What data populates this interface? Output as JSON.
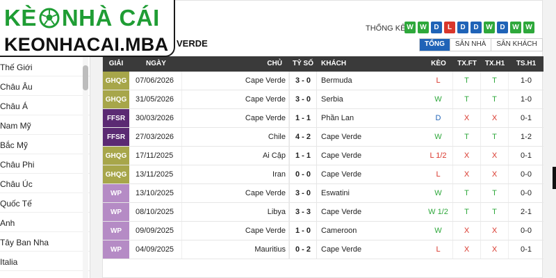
{
  "logo": {
    "line1_a": "KÈ",
    "line1_b": " NHÀ CÁI",
    "line2": "KEONHACAI.MBA"
  },
  "sidebar": {
    "items": [
      "Thế Giới",
      "Châu Âu",
      "Châu Á",
      "Nam Mỹ",
      "Bắc Mỹ",
      "Châu Phi",
      "Châu Úc",
      "Quốc Tế",
      "Anh",
      "Tây Ban Nha",
      "Italia"
    ]
  },
  "header": {
    "team_name": "VERDE",
    "stats_label": "THỐNG KÊ",
    "form": [
      "W",
      "W",
      "D",
      "L",
      "D",
      "D",
      "W",
      "D",
      "W",
      "W"
    ],
    "tabs": [
      "TỔNG",
      "SÂN NHÀ",
      "SÂN KHÁCH"
    ]
  },
  "table": {
    "headers": {
      "league": "GIẢI",
      "date": "NGÀY",
      "home": "CHỦ",
      "score": "TỶ SỐ",
      "away": "KHÁCH",
      "keo": "KÈO",
      "txft": "TX.FT",
      "txh1": "TX.H1",
      "tsh1": "TS.H1"
    },
    "rows": [
      {
        "league": "GHQG",
        "date": "07/06/2026",
        "home": "Cape Verde",
        "score": "3 - 0",
        "away": "Bermuda",
        "keo": "L",
        "txft": "T",
        "txh1": "T",
        "tsh1": "1-0"
      },
      {
        "league": "GHQG",
        "date": "31/05/2026",
        "home": "Cape Verde",
        "score": "3 - 0",
        "away": "Serbia",
        "keo": "W",
        "txft": "T",
        "txh1": "T",
        "tsh1": "1-0"
      },
      {
        "league": "FFSR",
        "date": "30/03/2026",
        "home": "Cape Verde",
        "score": "1 - 1",
        "away": "Phần Lan",
        "keo": "D",
        "txft": "X",
        "txh1": "X",
        "tsh1": "0-1"
      },
      {
        "league": "FFSR",
        "date": "27/03/2026",
        "home": "Chile",
        "score": "4 - 2",
        "away": "Cape Verde",
        "keo": "W",
        "txft": "T",
        "txh1": "T",
        "tsh1": "1-2"
      },
      {
        "league": "GHQG",
        "date": "17/11/2025",
        "home": "Ai Cập",
        "score": "1 - 1",
        "away": "Cape Verde",
        "keo": "L 1/2",
        "txft": "X",
        "txh1": "X",
        "tsh1": "0-1"
      },
      {
        "league": "GHQG",
        "date": "13/11/2025",
        "home": "Iran",
        "score": "0 - 0",
        "away": "Cape Verde",
        "keo": "L",
        "txft": "X",
        "txh1": "X",
        "tsh1": "0-0"
      },
      {
        "league": "WP",
        "date": "13/10/2025",
        "home": "Cape Verde",
        "score": "3 - 0",
        "away": "Eswatini",
        "keo": "W",
        "txft": "T",
        "txh1": "T",
        "tsh1": "0-0"
      },
      {
        "league": "WP",
        "date": "08/10/2025",
        "home": "Libya",
        "score": "3 - 3",
        "away": "Cape Verde",
        "keo": "W 1/2",
        "txft": "T",
        "txh1": "T",
        "tsh1": "2-1"
      },
      {
        "league": "WP",
        "date": "09/09/2025",
        "home": "Cape Verde",
        "score": "1 - 0",
        "away": "Cameroon",
        "keo": "W",
        "txft": "X",
        "txh1": "X",
        "tsh1": "0-0"
      },
      {
        "league": "WP",
        "date": "04/09/2025",
        "home": "Mauritius",
        "score": "0 - 2",
        "away": "Cape Verde",
        "keo": "L",
        "txft": "X",
        "txh1": "X",
        "tsh1": "0-1"
      }
    ]
  },
  "colors": {
    "logo_green": "#1f9d34",
    "header_bg": "#3a3a3a",
    "tab_active": "#1f63b7",
    "league": {
      "GHQG": "#a7a64a",
      "FFSR": "#5b2a73",
      "WP": "#b58bc5"
    },
    "form": {
      "W": "#2ea83b",
      "D": "#1f63b7",
      "L": "#d9362b"
    },
    "result": {
      "W": "#2ea83b",
      "D": "#1f63b7",
      "L": "#d9362b",
      "T": "#2ea83b",
      "X": "#d9362b"
    }
  }
}
